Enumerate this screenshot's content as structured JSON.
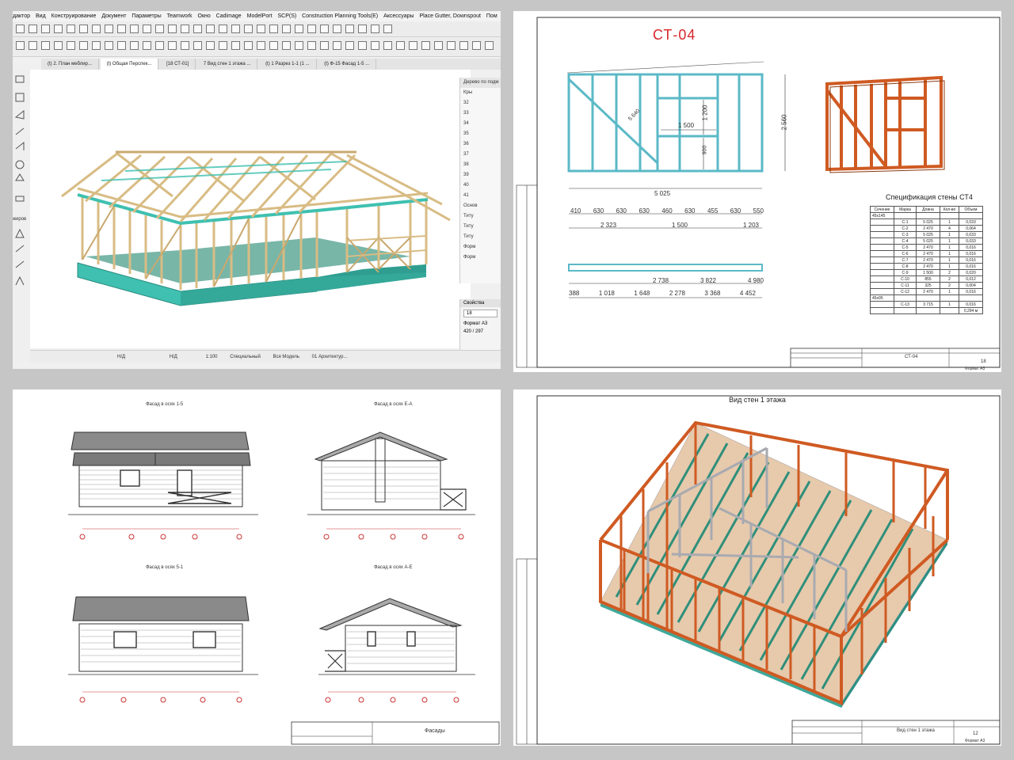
{
  "archicad": {
    "menu": [
      "дактор",
      "Вид",
      "Конструирование",
      "Документ",
      "Параметры",
      "Teamwork",
      "Окно",
      "Cadimage",
      "ModelPort",
      "SCP(S)",
      "Construction Planning Tools(E)",
      "Аксессуары",
      "Place Gutter, Downspout",
      "Пом"
    ],
    "tabs": [
      "(t) 2. План меблир...",
      "(t) Общая Перспек...",
      "[18 СТ-01]",
      "7 Вид стен 1 этажа ...",
      "(t) 1 Разрез 1-1 (1 ...",
      "(t) Ф-15 Фасад 1-5 ..."
    ],
    "active_tab": 1,
    "tree_title": "Дерево по подм",
    "tree_items": [
      "Кры",
      "32",
      "33",
      "34",
      "35",
      "36",
      "37",
      "38",
      "39",
      "40",
      "41",
      "Основ",
      "Титу",
      "Титу",
      "Титу",
      "Форм",
      "Форм"
    ],
    "props_title": "Свойства",
    "props_value": "18",
    "props_format": "Формат А3",
    "props_size": "420 / 297",
    "left_label": "жиров",
    "status": [
      "Н/Д",
      "Н/Д",
      "1:100",
      "Специальный",
      "Вся Модель",
      "01 Архитектур..."
    ]
  },
  "wall_sheet": {
    "title": "СТ-04",
    "dim_width": "5 025",
    "dim_height": "2 560",
    "dim_window_w": "1 500",
    "dim_window_h": "1 200",
    "dim_900": "900",
    "dim_diag": "5 640",
    "dim_row1": [
      "410",
      "630",
      "630",
      "630",
      "460",
      "630",
      "455",
      "630",
      "550"
    ],
    "dim_row2": [
      "2 323",
      "1 500",
      "1 203"
    ],
    "dim_plan": [
      "2 738",
      "3 822",
      "4 980"
    ],
    "dim_plan2": [
      "388",
      "1 018",
      "1 648",
      "2 278",
      "3 368",
      "4 452"
    ],
    "spec_title": "Спецификация стены СТ4",
    "spec_head": [
      "Сечение",
      "Марка",
      "Длина",
      "Кол-во",
      "Объем"
    ],
    "spec_section1": "45х145",
    "spec_rows": [
      [
        "С-1",
        "5 025",
        "1",
        "0,033"
      ],
      [
        "С-2",
        "2 470",
        "4",
        "0,064"
      ],
      [
        "С-3",
        "5 025",
        "1",
        "0,033"
      ],
      [
        "С-4",
        "5 025",
        "1",
        "0,033"
      ],
      [
        "С-5",
        "2 470",
        "1",
        "0,016"
      ],
      [
        "С-6",
        "2 470",
        "1",
        "0,016"
      ],
      [
        "С-7",
        "2 470",
        "1",
        "0,016"
      ],
      [
        "С-8",
        "2 470",
        "1",
        "0,016"
      ],
      [
        "С-9",
        "1 500",
        "2",
        "0,020"
      ],
      [
        "С-10",
        "855",
        "2",
        "0,012"
      ],
      [
        "С-11",
        "325",
        "2",
        "0,004"
      ],
      [
        "С-12",
        "2 470",
        "1",
        "0,016"
      ]
    ],
    "spec_section2": "45х95",
    "spec_row_last": [
      "С-13",
      "3 715",
      "1",
      "0,016"
    ],
    "spec_total": "0,294 м",
    "stamp_name": "СТ-04",
    "stamp_sheet": "18",
    "stamp_format": "Формат  А3"
  },
  "facades": {
    "titles": [
      "Фасад в осях 1-5",
      "Фасад в осях Е-А",
      "Фасад в осях 5-1",
      "Фасад в осях А-Е"
    ],
    "stamp_name": "Фасады"
  },
  "walls_view": {
    "title": "Вид стен 1 этажа",
    "stamp_name": "Вид стен 1 этажа",
    "stamp_sheet": "12",
    "stamp_format": "Формат  А3"
  },
  "colors": {
    "wood": "#d4b47c",
    "cyan_base": "#3fc0b0",
    "orange_frame": "#cf5a22",
    "red_title": "#d8262a",
    "green_beam": "#2f8f7a"
  }
}
